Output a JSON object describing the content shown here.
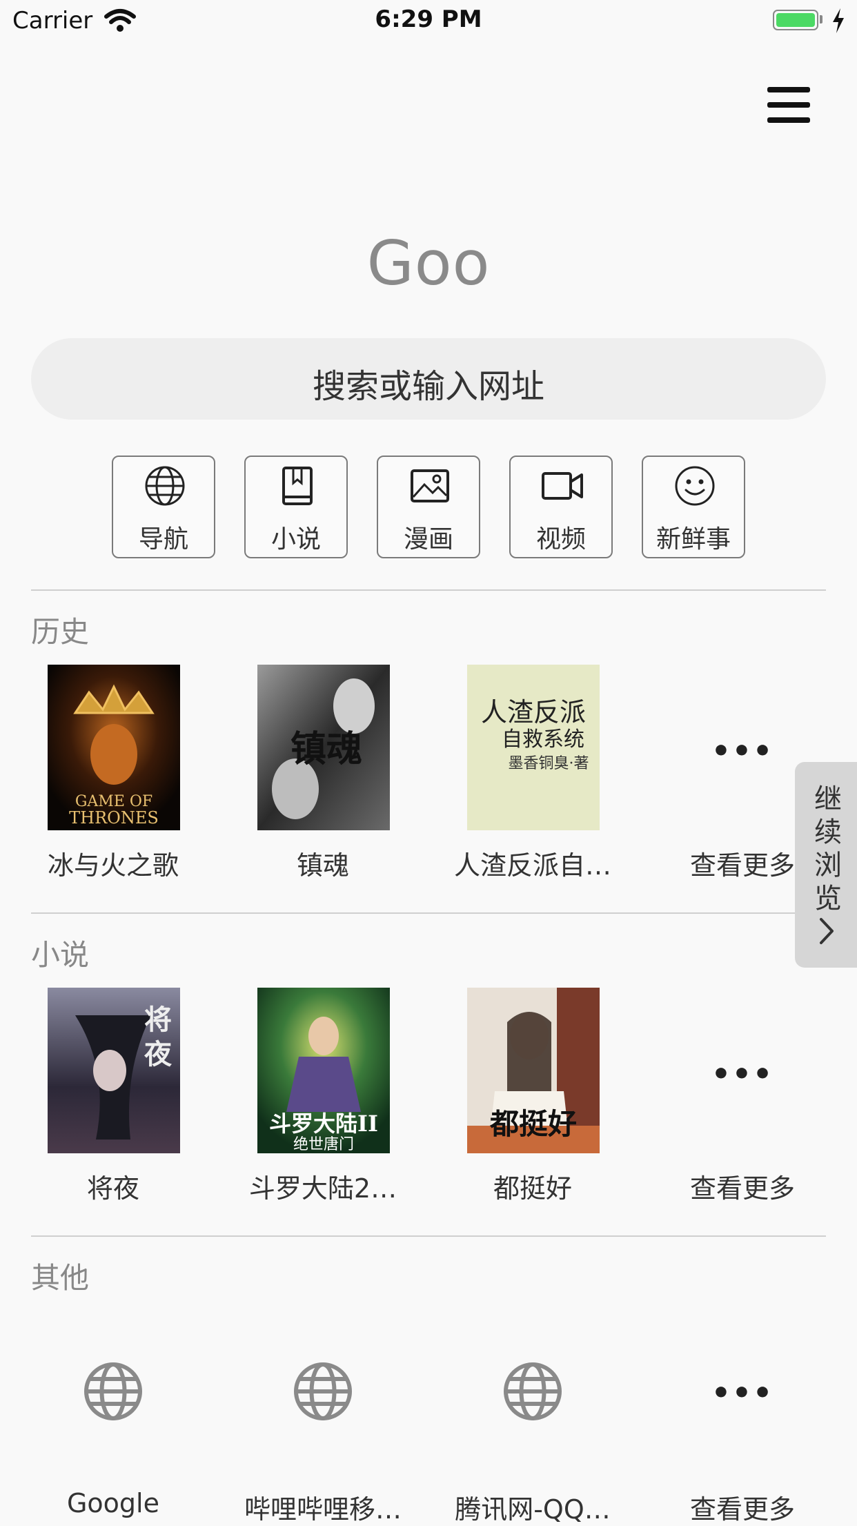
{
  "status_bar": {
    "carrier": "Carrier",
    "time": "6:29 PM",
    "battery_color": "#4cd964"
  },
  "logo": "Goo",
  "search": {
    "placeholder": "搜索或输入网址"
  },
  "quick_links": [
    {
      "label": "导航",
      "icon": "globe-icon"
    },
    {
      "label": "小说",
      "icon": "book-icon"
    },
    {
      "label": "漫画",
      "icon": "image-icon"
    },
    {
      "label": "视频",
      "icon": "video-camera-icon"
    },
    {
      "label": "新鲜事",
      "icon": "smiley-icon"
    }
  ],
  "sections": {
    "history": {
      "title": "历史",
      "items": [
        {
          "label": "冰与火之歌",
          "cover_text": "GAME OF THRONES"
        },
        {
          "label": "镇魂",
          "cover_text": "镇魂"
        },
        {
          "label": "人渣反派自…",
          "cover_text": "人渣反派自救系统"
        }
      ],
      "more_label": "查看更多"
    },
    "novels": {
      "title": "小说",
      "items": [
        {
          "label": "将夜",
          "cover_text": "将夜"
        },
        {
          "label": "斗罗大陆2…",
          "cover_text": "斗罗大陆II 绝世唐门"
        },
        {
          "label": "都挺好",
          "cover_text": "都挺好"
        }
      ],
      "more_label": "查看更多"
    },
    "other": {
      "title": "其他",
      "items": [
        {
          "label": "Google",
          "icon": "globe-icon"
        },
        {
          "label": "哔哩哔哩移…",
          "icon": "globe-icon"
        },
        {
          "label": "腾讯网-QQ…",
          "icon": "globe-icon"
        }
      ],
      "more_label": "查看更多"
    }
  },
  "continue_browsing": {
    "label": "继续浏览"
  },
  "more_dots": "•••"
}
